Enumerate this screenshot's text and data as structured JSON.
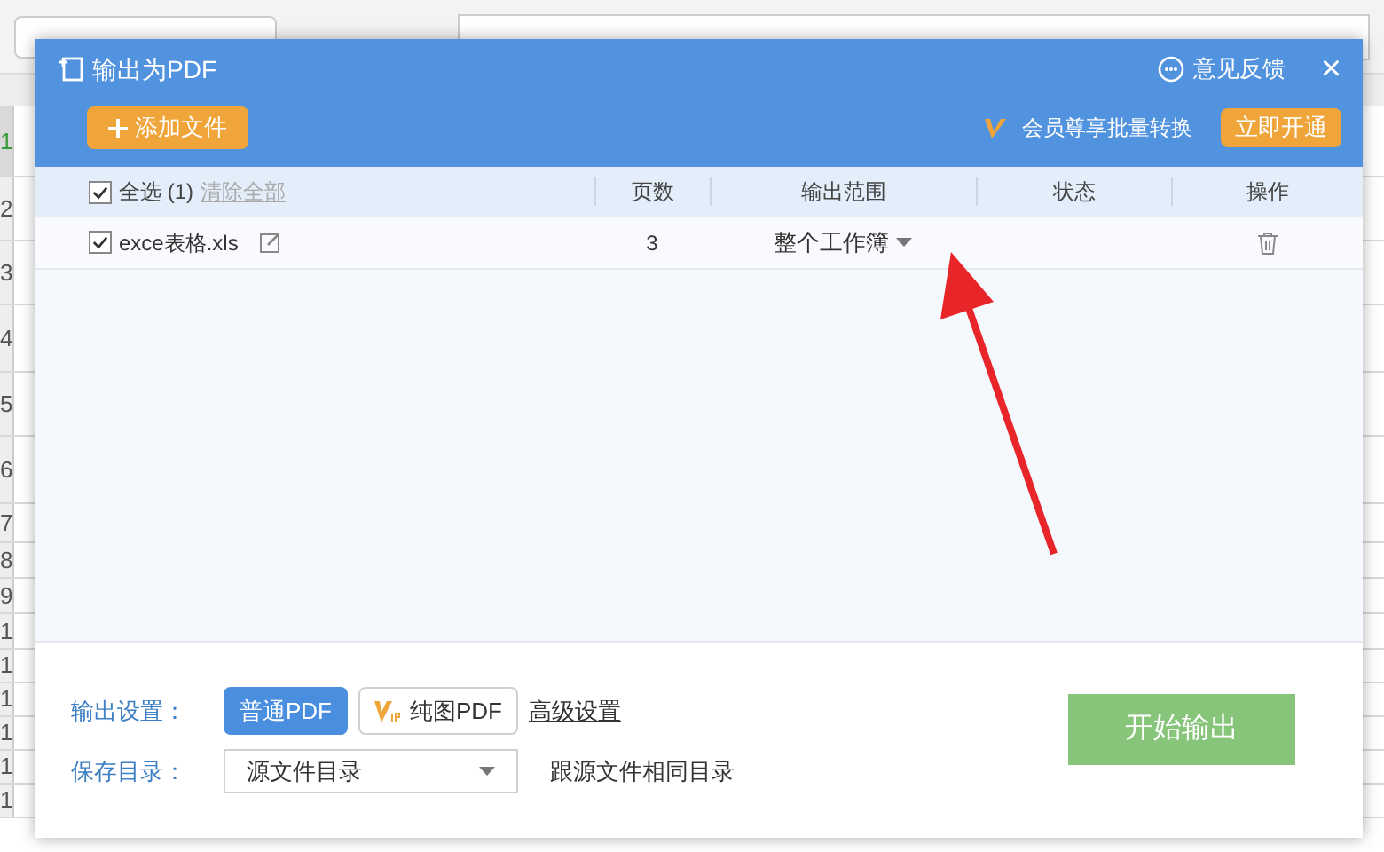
{
  "sheet": {
    "rows": [
      {
        "label": "1",
        "selected": true
      },
      {
        "label": "2",
        "selected": false
      },
      {
        "label": "3",
        "selected": false
      },
      {
        "label": "4",
        "selected": false
      },
      {
        "label": "5",
        "selected": false
      },
      {
        "label": "6",
        "selected": false
      },
      {
        "label": "7",
        "selected": false
      },
      {
        "label": "8",
        "selected": false
      },
      {
        "label": "9",
        "selected": false
      },
      {
        "label": "1",
        "selected": false
      },
      {
        "label": "1",
        "selected": false
      },
      {
        "label": "1",
        "selected": false
      },
      {
        "label": "1",
        "selected": false
      },
      {
        "label": "1",
        "selected": false
      },
      {
        "label": "1",
        "selected": false
      }
    ]
  },
  "dialog": {
    "title": "输出为PDF",
    "feedback": "意见反馈",
    "close": "×",
    "add_file": "添加文件",
    "promo": "会员尊享批量转换",
    "open_now": "立即开通",
    "table": {
      "select_all": {
        "label": "全选 (1)",
        "checked": true
      },
      "clear_all": "清除全部",
      "columns": [
        "页数",
        "输出范围",
        "状态",
        "操作"
      ],
      "rows": [
        {
          "checked": true,
          "file": "exce表格.xls",
          "pages": "3",
          "range": "整个工作簿"
        }
      ]
    },
    "settings": {
      "output_label": "输出设置：",
      "modes": [
        {
          "label": "普通PDF",
          "selected": true,
          "vip": false
        },
        {
          "label": "纯图PDF",
          "selected": false,
          "vip": true
        }
      ],
      "advanced": "高级设置",
      "save_label": "保存目录：",
      "save_dir": "源文件目录",
      "save_hint": "跟源文件相同目录",
      "start": "开始输出"
    }
  }
}
